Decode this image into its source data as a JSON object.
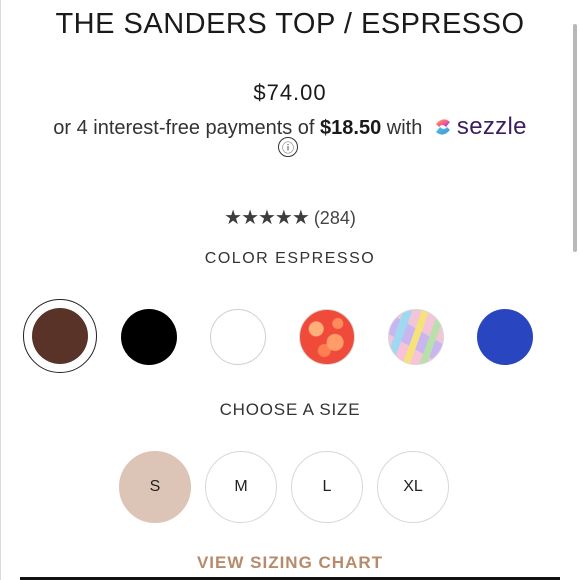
{
  "product": {
    "title": "THE SANDERS TOP / ESPRESSO",
    "price": "$74.00"
  },
  "sezzle": {
    "prefix": "or 4 interest-free payments of",
    "amount": "$18.50",
    "with": "with",
    "brand": "sezzle",
    "info_icon": "ⓘ"
  },
  "rating": {
    "stars": "★★★★★",
    "count": "(284)"
  },
  "color": {
    "label": "COLOR",
    "selected": "ESPRESSO",
    "swatches": [
      {
        "name": "espresso",
        "color": "#5a3328"
      },
      {
        "name": "black",
        "color": "#000000"
      },
      {
        "name": "white",
        "color": "#ffffff"
      },
      {
        "name": "floral-print",
        "color": "#f0553c"
      },
      {
        "name": "pastel-swirl",
        "color": "#f2c6d8"
      },
      {
        "name": "royal-blue",
        "color": "#2a45c0"
      }
    ]
  },
  "size": {
    "label": "CHOOSE A SIZE",
    "options": [
      "S",
      "M",
      "L",
      "XL"
    ],
    "selected": "S"
  },
  "sizing_chart": "VIEW SIZING CHART",
  "accent": "#b78a6a"
}
